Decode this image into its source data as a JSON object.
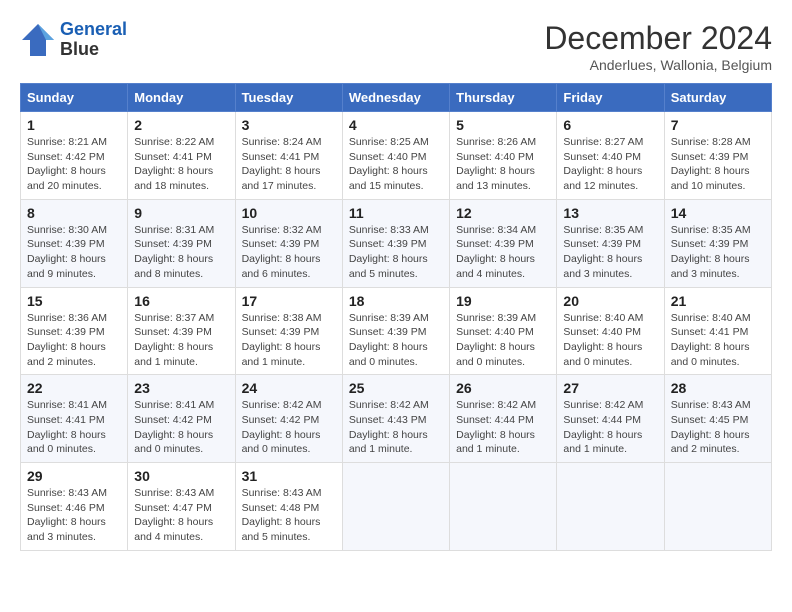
{
  "header": {
    "logo_line1": "General",
    "logo_line2": "Blue",
    "month_title": "December 2024",
    "subtitle": "Anderlues, Wallonia, Belgium"
  },
  "calendar": {
    "days_of_week": [
      "Sunday",
      "Monday",
      "Tuesday",
      "Wednesday",
      "Thursday",
      "Friday",
      "Saturday"
    ],
    "weeks": [
      [
        {
          "day": "1",
          "sunrise": "8:21 AM",
          "sunset": "4:42 PM",
          "daylight": "8 hours and 20 minutes."
        },
        {
          "day": "2",
          "sunrise": "8:22 AM",
          "sunset": "4:41 PM",
          "daylight": "8 hours and 18 minutes."
        },
        {
          "day": "3",
          "sunrise": "8:24 AM",
          "sunset": "4:41 PM",
          "daylight": "8 hours and 17 minutes."
        },
        {
          "day": "4",
          "sunrise": "8:25 AM",
          "sunset": "4:40 PM",
          "daylight": "8 hours and 15 minutes."
        },
        {
          "day": "5",
          "sunrise": "8:26 AM",
          "sunset": "4:40 PM",
          "daylight": "8 hours and 13 minutes."
        },
        {
          "day": "6",
          "sunrise": "8:27 AM",
          "sunset": "4:40 PM",
          "daylight": "8 hours and 12 minutes."
        },
        {
          "day": "7",
          "sunrise": "8:28 AM",
          "sunset": "4:39 PM",
          "daylight": "8 hours and 10 minutes."
        }
      ],
      [
        {
          "day": "8",
          "sunrise": "8:30 AM",
          "sunset": "4:39 PM",
          "daylight": "8 hours and 9 minutes."
        },
        {
          "day": "9",
          "sunrise": "8:31 AM",
          "sunset": "4:39 PM",
          "daylight": "8 hours and 8 minutes."
        },
        {
          "day": "10",
          "sunrise": "8:32 AM",
          "sunset": "4:39 PM",
          "daylight": "8 hours and 6 minutes."
        },
        {
          "day": "11",
          "sunrise": "8:33 AM",
          "sunset": "4:39 PM",
          "daylight": "8 hours and 5 minutes."
        },
        {
          "day": "12",
          "sunrise": "8:34 AM",
          "sunset": "4:39 PM",
          "daylight": "8 hours and 4 minutes."
        },
        {
          "day": "13",
          "sunrise": "8:35 AM",
          "sunset": "4:39 PM",
          "daylight": "8 hours and 3 minutes."
        },
        {
          "day": "14",
          "sunrise": "8:35 AM",
          "sunset": "4:39 PM",
          "daylight": "8 hours and 3 minutes."
        }
      ],
      [
        {
          "day": "15",
          "sunrise": "8:36 AM",
          "sunset": "4:39 PM",
          "daylight": "8 hours and 2 minutes."
        },
        {
          "day": "16",
          "sunrise": "8:37 AM",
          "sunset": "4:39 PM",
          "daylight": "8 hours and 1 minute."
        },
        {
          "day": "17",
          "sunrise": "8:38 AM",
          "sunset": "4:39 PM",
          "daylight": "8 hours and 1 minute."
        },
        {
          "day": "18",
          "sunrise": "8:39 AM",
          "sunset": "4:39 PM",
          "daylight": "8 hours and 0 minutes."
        },
        {
          "day": "19",
          "sunrise": "8:39 AM",
          "sunset": "4:40 PM",
          "daylight": "8 hours and 0 minutes."
        },
        {
          "day": "20",
          "sunrise": "8:40 AM",
          "sunset": "4:40 PM",
          "daylight": "8 hours and 0 minutes."
        },
        {
          "day": "21",
          "sunrise": "8:40 AM",
          "sunset": "4:41 PM",
          "daylight": "8 hours and 0 minutes."
        }
      ],
      [
        {
          "day": "22",
          "sunrise": "8:41 AM",
          "sunset": "4:41 PM",
          "daylight": "8 hours and 0 minutes."
        },
        {
          "day": "23",
          "sunrise": "8:41 AM",
          "sunset": "4:42 PM",
          "daylight": "8 hours and 0 minutes."
        },
        {
          "day": "24",
          "sunrise": "8:42 AM",
          "sunset": "4:42 PM",
          "daylight": "8 hours and 0 minutes."
        },
        {
          "day": "25",
          "sunrise": "8:42 AM",
          "sunset": "4:43 PM",
          "daylight": "8 hours and 1 minute."
        },
        {
          "day": "26",
          "sunrise": "8:42 AM",
          "sunset": "4:44 PM",
          "daylight": "8 hours and 1 minute."
        },
        {
          "day": "27",
          "sunrise": "8:42 AM",
          "sunset": "4:44 PM",
          "daylight": "8 hours and 1 minute."
        },
        {
          "day": "28",
          "sunrise": "8:43 AM",
          "sunset": "4:45 PM",
          "daylight": "8 hours and 2 minutes."
        }
      ],
      [
        {
          "day": "29",
          "sunrise": "8:43 AM",
          "sunset": "4:46 PM",
          "daylight": "8 hours and 3 minutes."
        },
        {
          "day": "30",
          "sunrise": "8:43 AM",
          "sunset": "4:47 PM",
          "daylight": "8 hours and 4 minutes."
        },
        {
          "day": "31",
          "sunrise": "8:43 AM",
          "sunset": "4:48 PM",
          "daylight": "8 hours and 5 minutes."
        },
        null,
        null,
        null,
        null
      ]
    ]
  }
}
